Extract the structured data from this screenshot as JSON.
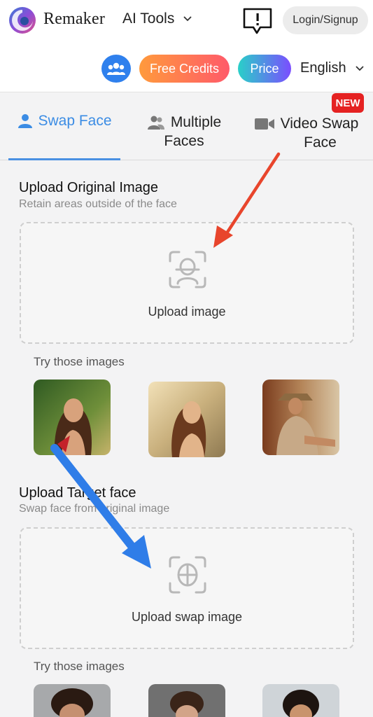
{
  "header": {
    "brand": "Remaker",
    "menu_label": "AI Tools",
    "login_label": "Login/Signup",
    "free_credits_label": "Free Credits",
    "price_label": "Price",
    "language_label": "English"
  },
  "tabs": [
    {
      "label": "Swap Face",
      "active": true
    },
    {
      "label_line1": "Multiple",
      "label_line2": "Faces"
    },
    {
      "label_line1": "Video Swap",
      "label_line2": "Face",
      "badge": "NEW"
    }
  ],
  "original": {
    "title": "Upload Original Image",
    "subtitle": "Retain areas outside of the face",
    "upload_label": "Upload image",
    "try_label": "Try those images"
  },
  "target": {
    "title": "Upload Target face",
    "subtitle": "Swap face from original image",
    "upload_label": "Upload swap image",
    "try_label": "Try those images"
  },
  "colors": {
    "accent_blue": "#3b8ce4",
    "free_credits_gradient": [
      "#ff9a3c",
      "#ff5a6a"
    ],
    "price_gradient": [
      "#29d0c8",
      "#7b4dff"
    ],
    "new_badge": "#e52222",
    "annotation_red": "#e8452c",
    "annotation_blue": "#2f7de8"
  }
}
